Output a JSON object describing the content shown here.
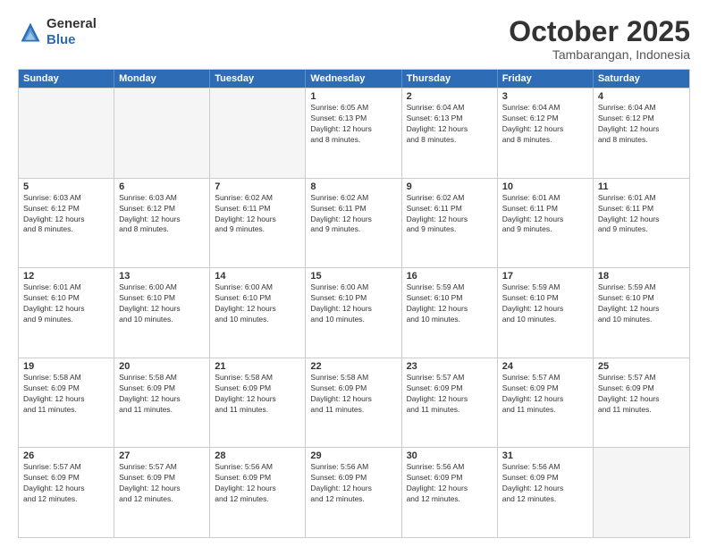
{
  "header": {
    "logo_general": "General",
    "logo_blue": "Blue",
    "month_title": "October 2025",
    "location": "Tambarangan, Indonesia"
  },
  "weekdays": [
    "Sunday",
    "Monday",
    "Tuesday",
    "Wednesday",
    "Thursday",
    "Friday",
    "Saturday"
  ],
  "rows": [
    [
      {
        "day": "",
        "info": "",
        "empty": true
      },
      {
        "day": "",
        "info": "",
        "empty": true
      },
      {
        "day": "",
        "info": "",
        "empty": true
      },
      {
        "day": "1",
        "info": "Sunrise: 6:05 AM\nSunset: 6:13 PM\nDaylight: 12 hours\nand 8 minutes.",
        "empty": false
      },
      {
        "day": "2",
        "info": "Sunrise: 6:04 AM\nSunset: 6:13 PM\nDaylight: 12 hours\nand 8 minutes.",
        "empty": false
      },
      {
        "day": "3",
        "info": "Sunrise: 6:04 AM\nSunset: 6:12 PM\nDaylight: 12 hours\nand 8 minutes.",
        "empty": false
      },
      {
        "day": "4",
        "info": "Sunrise: 6:04 AM\nSunset: 6:12 PM\nDaylight: 12 hours\nand 8 minutes.",
        "empty": false
      }
    ],
    [
      {
        "day": "5",
        "info": "Sunrise: 6:03 AM\nSunset: 6:12 PM\nDaylight: 12 hours\nand 8 minutes.",
        "empty": false
      },
      {
        "day": "6",
        "info": "Sunrise: 6:03 AM\nSunset: 6:12 PM\nDaylight: 12 hours\nand 8 minutes.",
        "empty": false
      },
      {
        "day": "7",
        "info": "Sunrise: 6:02 AM\nSunset: 6:11 PM\nDaylight: 12 hours\nand 9 minutes.",
        "empty": false
      },
      {
        "day": "8",
        "info": "Sunrise: 6:02 AM\nSunset: 6:11 PM\nDaylight: 12 hours\nand 9 minutes.",
        "empty": false
      },
      {
        "day": "9",
        "info": "Sunrise: 6:02 AM\nSunset: 6:11 PM\nDaylight: 12 hours\nand 9 minutes.",
        "empty": false
      },
      {
        "day": "10",
        "info": "Sunrise: 6:01 AM\nSunset: 6:11 PM\nDaylight: 12 hours\nand 9 minutes.",
        "empty": false
      },
      {
        "day": "11",
        "info": "Sunrise: 6:01 AM\nSunset: 6:11 PM\nDaylight: 12 hours\nand 9 minutes.",
        "empty": false
      }
    ],
    [
      {
        "day": "12",
        "info": "Sunrise: 6:01 AM\nSunset: 6:10 PM\nDaylight: 12 hours\nand 9 minutes.",
        "empty": false
      },
      {
        "day": "13",
        "info": "Sunrise: 6:00 AM\nSunset: 6:10 PM\nDaylight: 12 hours\nand 10 minutes.",
        "empty": false
      },
      {
        "day": "14",
        "info": "Sunrise: 6:00 AM\nSunset: 6:10 PM\nDaylight: 12 hours\nand 10 minutes.",
        "empty": false
      },
      {
        "day": "15",
        "info": "Sunrise: 6:00 AM\nSunset: 6:10 PM\nDaylight: 12 hours\nand 10 minutes.",
        "empty": false
      },
      {
        "day": "16",
        "info": "Sunrise: 5:59 AM\nSunset: 6:10 PM\nDaylight: 12 hours\nand 10 minutes.",
        "empty": false
      },
      {
        "day": "17",
        "info": "Sunrise: 5:59 AM\nSunset: 6:10 PM\nDaylight: 12 hours\nand 10 minutes.",
        "empty": false
      },
      {
        "day": "18",
        "info": "Sunrise: 5:59 AM\nSunset: 6:10 PM\nDaylight: 12 hours\nand 10 minutes.",
        "empty": false
      }
    ],
    [
      {
        "day": "19",
        "info": "Sunrise: 5:58 AM\nSunset: 6:09 PM\nDaylight: 12 hours\nand 11 minutes.",
        "empty": false
      },
      {
        "day": "20",
        "info": "Sunrise: 5:58 AM\nSunset: 6:09 PM\nDaylight: 12 hours\nand 11 minutes.",
        "empty": false
      },
      {
        "day": "21",
        "info": "Sunrise: 5:58 AM\nSunset: 6:09 PM\nDaylight: 12 hours\nand 11 minutes.",
        "empty": false
      },
      {
        "day": "22",
        "info": "Sunrise: 5:58 AM\nSunset: 6:09 PM\nDaylight: 12 hours\nand 11 minutes.",
        "empty": false
      },
      {
        "day": "23",
        "info": "Sunrise: 5:57 AM\nSunset: 6:09 PM\nDaylight: 12 hours\nand 11 minutes.",
        "empty": false
      },
      {
        "day": "24",
        "info": "Sunrise: 5:57 AM\nSunset: 6:09 PM\nDaylight: 12 hours\nand 11 minutes.",
        "empty": false
      },
      {
        "day": "25",
        "info": "Sunrise: 5:57 AM\nSunset: 6:09 PM\nDaylight: 12 hours\nand 11 minutes.",
        "empty": false
      }
    ],
    [
      {
        "day": "26",
        "info": "Sunrise: 5:57 AM\nSunset: 6:09 PM\nDaylight: 12 hours\nand 12 minutes.",
        "empty": false
      },
      {
        "day": "27",
        "info": "Sunrise: 5:57 AM\nSunset: 6:09 PM\nDaylight: 12 hours\nand 12 minutes.",
        "empty": false
      },
      {
        "day": "28",
        "info": "Sunrise: 5:56 AM\nSunset: 6:09 PM\nDaylight: 12 hours\nand 12 minutes.",
        "empty": false
      },
      {
        "day": "29",
        "info": "Sunrise: 5:56 AM\nSunset: 6:09 PM\nDaylight: 12 hours\nand 12 minutes.",
        "empty": false
      },
      {
        "day": "30",
        "info": "Sunrise: 5:56 AM\nSunset: 6:09 PM\nDaylight: 12 hours\nand 12 minutes.",
        "empty": false
      },
      {
        "day": "31",
        "info": "Sunrise: 5:56 AM\nSunset: 6:09 PM\nDaylight: 12 hours\nand 12 minutes.",
        "empty": false
      },
      {
        "day": "",
        "info": "",
        "empty": true
      }
    ]
  ]
}
